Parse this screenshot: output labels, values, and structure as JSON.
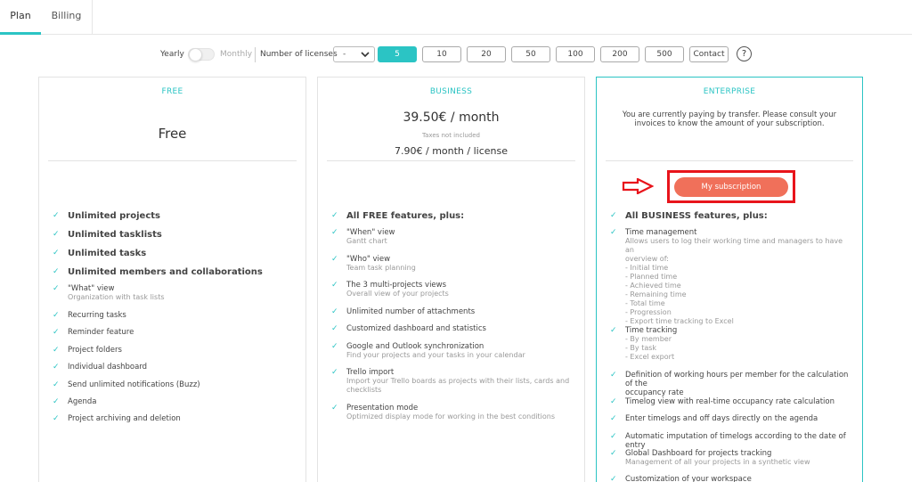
{
  "tabs": [
    "Plan",
    "Billing"
  ],
  "controls": {
    "yearly": "Yearly",
    "monthly": "Monthly",
    "licenses_label": "Number of licenses",
    "select_value": "-",
    "license_options": [
      "5",
      "10",
      "20",
      "50",
      "100",
      "200",
      "500",
      "Contact"
    ],
    "help": "?"
  },
  "plans": {
    "free": {
      "title": "FREE",
      "price": "Free",
      "features": [
        {
          "text": "Unlimited projects",
          "bold": true
        },
        {
          "text": "Unlimited tasklists",
          "bold": true
        },
        {
          "text": "Unlimited tasks",
          "bold": true
        },
        {
          "text": "Unlimited members and collaborations",
          "bold": true
        },
        {
          "text": "\"What\" view",
          "sub": "Organization with task lists"
        },
        {
          "text": "Recurring tasks"
        },
        {
          "text": "Reminder feature"
        },
        {
          "text": "Project folders"
        },
        {
          "text": "Individual dashboard"
        },
        {
          "text": "Send unlimited notifications (Buzz)"
        },
        {
          "text": "Agenda"
        },
        {
          "text": "Project archiving and deletion"
        }
      ]
    },
    "business": {
      "title": "BUSINESS",
      "price": "39.50€ / month",
      "taxes": "Taxes not included",
      "per_license": "7.90€ / month / license",
      "features": [
        {
          "text": "All FREE features, plus:",
          "bold": true
        },
        {
          "text": "\"When\" view",
          "sub": "Gantt chart"
        },
        {
          "text": "\"Who\" view",
          "sub": "Team task planning"
        },
        {
          "text": "The 3 multi-projects views",
          "sub": "Overall view of your projects"
        },
        {
          "text": "Unlimited number of attachments"
        },
        {
          "text": "Customized dashboard and statistics"
        },
        {
          "text": "Google and Outlook synchronization",
          "sub": "Find your projects and your tasks in your calendar"
        },
        {
          "text": "Trello import",
          "sub": "Import your Trello boards as projects with their lists, cards and\nchecklists"
        },
        {
          "text": "Presentation mode",
          "sub": "Optimized display mode for working in the best conditions"
        }
      ]
    },
    "enterprise": {
      "title": "ENTERPRISE",
      "note": "You are currently paying by transfer. Please consult your invoices to know the amount of your subscription.",
      "button": "My subscription",
      "features": [
        {
          "text": "All BUSINESS features, plus:",
          "bold": true
        },
        {
          "text": "Time management",
          "sub": "Allows users to log their working time and managers to have an\noverview of:\n- Initial time\n- Planned time\n- Achieved time\n- Remaining time\n- Total time\n- Progression\n- Export time tracking to Excel"
        },
        {
          "text": "Time tracking",
          "sub": "- By member\n- By task\n- Excel export"
        },
        {
          "text": "Definition of working hours per member for the calculation of the\noccupancy rate"
        },
        {
          "text": "Timelog view with real-time occupancy rate calculation"
        },
        {
          "text": "Enter timelogs and off days directly on the agenda"
        },
        {
          "text": "Automatic imputation of timelogs according to the date of entry"
        },
        {
          "text": "Global Dashboard for projects tracking",
          "sub": "Management of all your projects in a synthetic view"
        },
        {
          "text": "Customization of your workspace"
        }
      ]
    }
  },
  "colors": {
    "accent": "#2bc4c4",
    "button": "#f0705a",
    "highlight": "#e8141b"
  }
}
